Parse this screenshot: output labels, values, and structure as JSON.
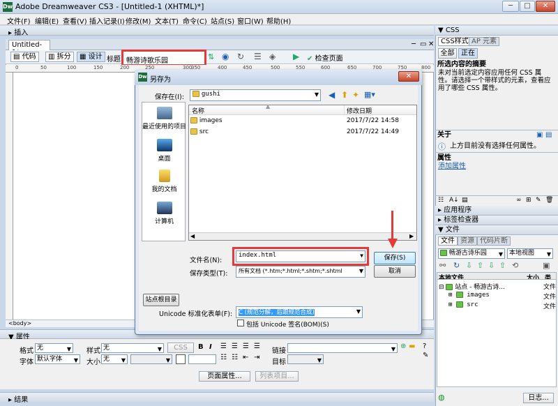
{
  "window": {
    "logo": "Dw",
    "title": "Adobe Dreamweaver CS3 - [Untitled-1 (XHTML)*]",
    "min": "─",
    "max": "□",
    "close": "✕"
  },
  "menu": [
    "文件(F)",
    "编辑(E)",
    "查看(V)",
    "插入记录(I)",
    "修改(M)",
    "文本(T)",
    "命令(C)",
    "站点(S)",
    "窗口(W)",
    "帮助(H)"
  ],
  "insert_bar": {
    "label": "▸ 插入"
  },
  "document": {
    "tab": "Untitled-1*",
    "view_code": "代码",
    "view_split": "拆分",
    "view_design": "设计",
    "title_label": "标题:",
    "title_value": "畅游诗歌乐园",
    "check_page": "检查页面",
    "ruler_marks": [
      "0",
      "50",
      "100",
      "150",
      "200",
      "250",
      "300",
      "350",
      "400",
      "450",
      "500",
      "550",
      "600",
      "650",
      "700",
      "750",
      "800"
    ],
    "status_tag": "<body>"
  },
  "properties": {
    "header": "▼ 属性",
    "format_label": "格式",
    "format_value": "无",
    "style_label": "样式",
    "style_value": "无",
    "css_btn": "CSS",
    "bold": "B",
    "italic": "I",
    "link_label": "链接",
    "font_label": "字体",
    "font_value": "默认字体",
    "size_label": "大小",
    "size_value": "无",
    "target_label": "目标",
    "page_props": "页面属性...",
    "list_item": "列表项目..."
  },
  "results": {
    "header": "▸ 结果"
  },
  "css_panel": {
    "header": "▼ CSS",
    "tab_css": "CSS样式",
    "tab_ap": "AP 元素",
    "btn_all": "全部",
    "btn_current": "正在",
    "summary_title": "所选内容的摘要",
    "summary_text": "未对当前选定内容应用任何 CSS 属性。请选择一个带样式的元素，查看应用了哪些 CSS 属性。",
    "about_title": "关于",
    "about_text": "上方目前没有选择任何属性。",
    "attrs_title": "属性",
    "add_attr": "添加属性"
  },
  "app_panel": {
    "header": "▸ 应用程序"
  },
  "tag_panel": {
    "header": "▸ 标签检查器"
  },
  "files_panel": {
    "header": "▼ 文件",
    "tab_files": "文件",
    "tab_assets": "资源",
    "tab_snippets": "代码片断",
    "site_select": "畅游古诗乐园",
    "view_select": "本地视图",
    "col_local": "本地文件",
    "col_size": "大小",
    "col_type": "类型",
    "rows": [
      {
        "name": "站点 - 畅游古诗...",
        "type": "文件"
      },
      {
        "name": "images",
        "type": "文件"
      },
      {
        "name": "src",
        "type": "文件"
      }
    ],
    "log_btn": "日志..."
  },
  "dialog": {
    "logo": "Dw",
    "title": "另存为",
    "close": "✕",
    "save_in_label": "保存在(I):",
    "save_in_value": "gushi",
    "places": [
      "最近使用的项目",
      "桌面",
      "我的文档",
      "计算机"
    ],
    "col_name": "名称",
    "col_date": "修改日期",
    "files": [
      {
        "name": "images",
        "date": "2017/7/22 14:58"
      },
      {
        "name": "src",
        "date": "2017/7/22 14:49"
      }
    ],
    "filename_label": "文件名(N):",
    "filename_value": "index.html",
    "filetype_label": "保存类型(T):",
    "filetype_value": "所有文档 (*.htm;*.html;*.shtm;*.shtml",
    "save_btn": "保存(S)",
    "cancel_btn": "取消",
    "site_root_btn": "站点根目录",
    "unicode_label": "Unicode 标准化表单(F):",
    "unicode_value": "C (规范分解，后跟规范合成)",
    "bom_label": "包括 Unicode 签名(BOM)(S)"
  }
}
